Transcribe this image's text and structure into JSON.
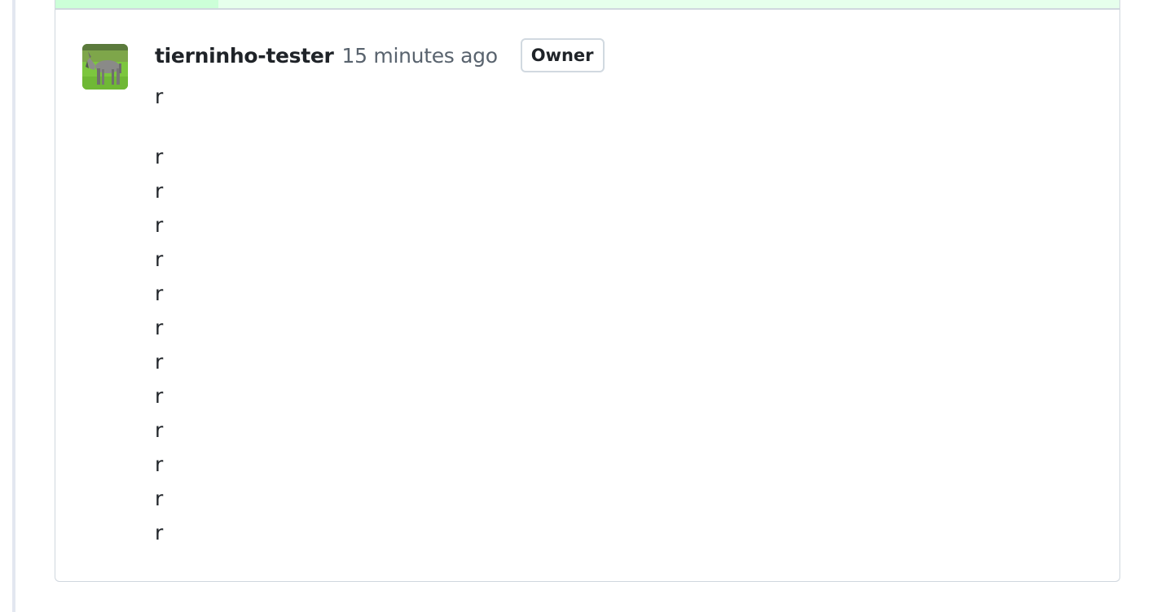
{
  "comment": {
    "author": "tierninho-tester",
    "timestamp": "15 minutes ago",
    "role_badge": "Owner",
    "avatar_icon": "donkey-avatar-photo",
    "body_lines": [
      "r",
      "r",
      "r",
      "r",
      "r",
      "r",
      "r",
      "r",
      "r",
      "r",
      "r",
      "r",
      "r"
    ]
  },
  "colors": {
    "diff_added_bg": "#e6ffec",
    "diff_added_marker": "#ccffd8",
    "border": "#d0d7de",
    "muted_text": "#59636e"
  }
}
